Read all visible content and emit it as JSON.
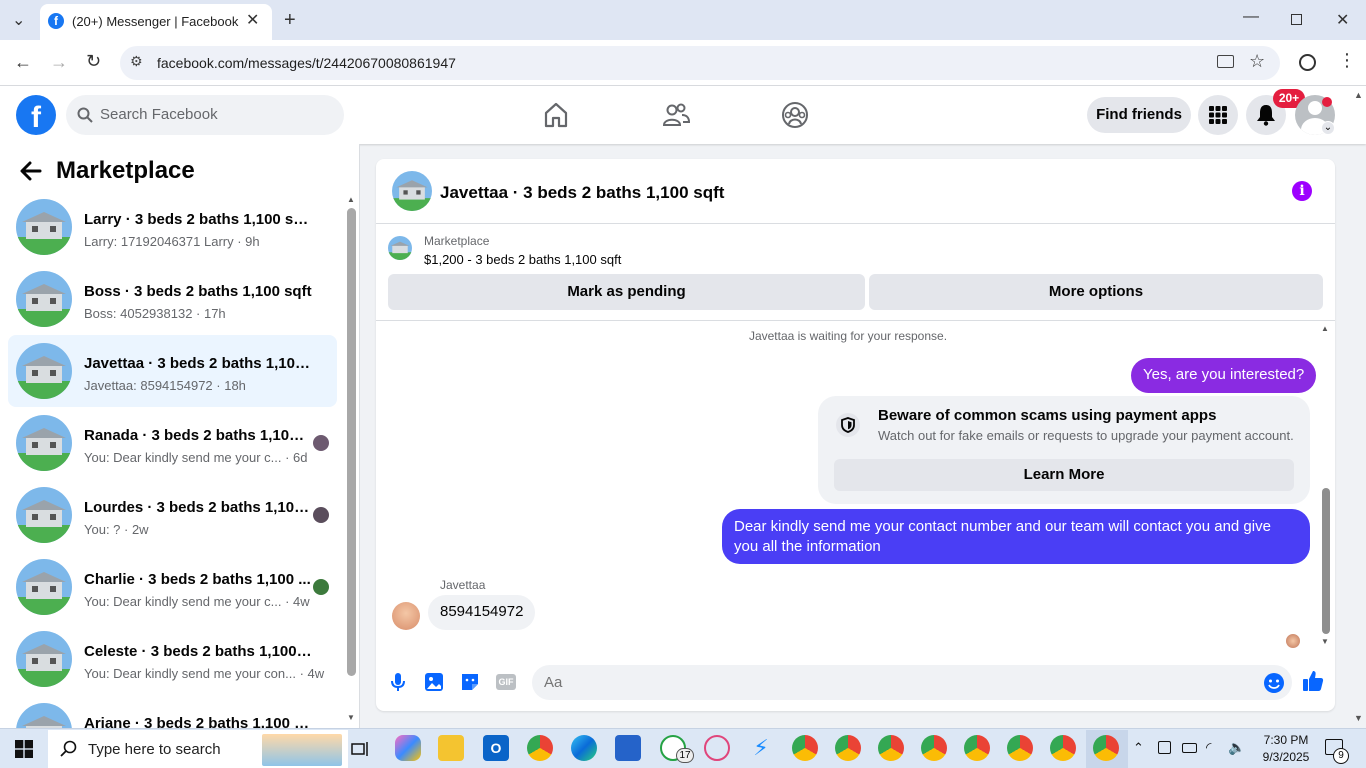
{
  "browser": {
    "tab_title": "(20+) Messenger | Facebook",
    "url": "facebook.com/messages/t/24420670080861947"
  },
  "header": {
    "search_placeholder": "Search Facebook",
    "find_friends": "Find friends",
    "notification_badge": "20+"
  },
  "sidebar": {
    "title": "Marketplace",
    "conversations": [
      {
        "name": "Larry · 3 beds 2 baths 1,100 sqft",
        "preview": "Larry: 17192046371 Larry · 9h",
        "active": false
      },
      {
        "name": "Boss · 3 beds 2 baths 1,100 sqft",
        "preview": "Boss: 4052938132 · 17h",
        "active": false
      },
      {
        "name": "Javettaa · 3 beds 2 baths 1,100 s...",
        "preview": "Javettaa: 8594154972 · 18h",
        "active": true
      },
      {
        "name": "Ranada · 3 beds 2 baths 1,100 ...",
        "preview": "You: Dear kindly send me your c... · 6d",
        "active": false
      },
      {
        "name": "Lourdes · 3 beds 2 baths 1,100...",
        "preview": "You: ? · 2w",
        "active": false
      },
      {
        "name": "Charlie · 3 beds 2 baths 1,100 ...",
        "preview": "You: Dear kindly send me your c... · 4w",
        "active": false
      },
      {
        "name": "Celeste · 3 beds 2 baths 1,100 sqft",
        "preview": "You: Dear kindly send me your con... · 4w",
        "active": false
      },
      {
        "name": "Ariane · 3 beds 2 baths 1,100 sqft",
        "preview": "",
        "active": false
      }
    ]
  },
  "chat": {
    "title": "Javettaa · 3 beds 2 baths 1,100 sqft",
    "marketplace_label": "Marketplace",
    "listing": "$1,200 - 3 beds 2 baths 1,100 sqft",
    "mark_pending": "Mark as pending",
    "more_options": "More options",
    "waiting": "Javettaa is waiting for your response.",
    "msg_out_1": "Yes, are you interested?",
    "scam_title": "Beware of common scams using payment apps",
    "scam_body": "Watch out for fake emails or requests to upgrade your payment account.",
    "learn_more": "Learn More",
    "msg_out_2": "Dear kindly send me your contact number and our team will contact you and give you all the information",
    "sender_name": "Javettaa",
    "msg_in_1": "8594154972",
    "composer_placeholder": "Aa"
  },
  "taskbar": {
    "search_placeholder": "Type here to search",
    "time": "7:30 PM",
    "date": "9/3/2025",
    "whatsapp_badge": "17",
    "notif_count": "9"
  },
  "colors": {
    "fb_blue": "#1877f2",
    "bubble_purple": "#8a2be2",
    "bubble_blue": "#4a3ef5",
    "active_bg": "#ebf5ff"
  }
}
